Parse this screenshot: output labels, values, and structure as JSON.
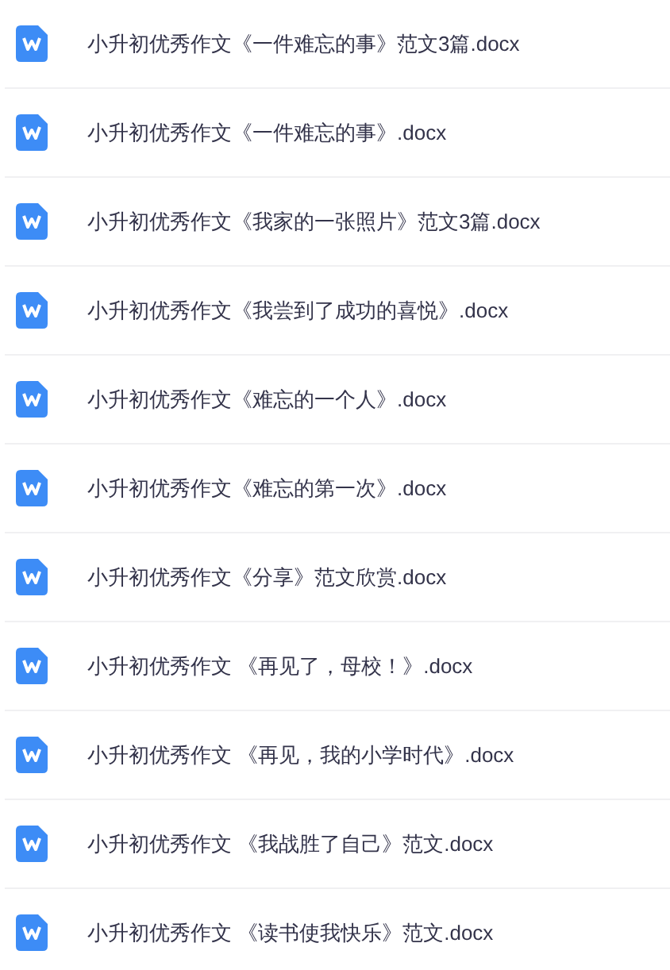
{
  "files": [
    {
      "name": "小升初优秀作文《一件难忘的事》范文3篇.docx"
    },
    {
      "name": "小升初优秀作文《一件难忘的事》.docx"
    },
    {
      "name": "小升初优秀作文《我家的一张照片》范文3篇.docx"
    },
    {
      "name": "小升初优秀作文《我尝到了成功的喜悦》.docx"
    },
    {
      "name": "小升初优秀作文《难忘的一个人》.docx"
    },
    {
      "name": "小升初优秀作文《难忘的第一次》.docx"
    },
    {
      "name": "小升初优秀作文《分享》范文欣赏.docx"
    },
    {
      "name": "小升初优秀作文 《再见了，母校！》.docx"
    },
    {
      "name": "小升初优秀作文 《再见，我的小学时代》.docx"
    },
    {
      "name": "小升初优秀作文 《我战胜了自己》范文.docx"
    },
    {
      "name": "小升初优秀作文 《读书使我快乐》范文.docx"
    }
  ]
}
